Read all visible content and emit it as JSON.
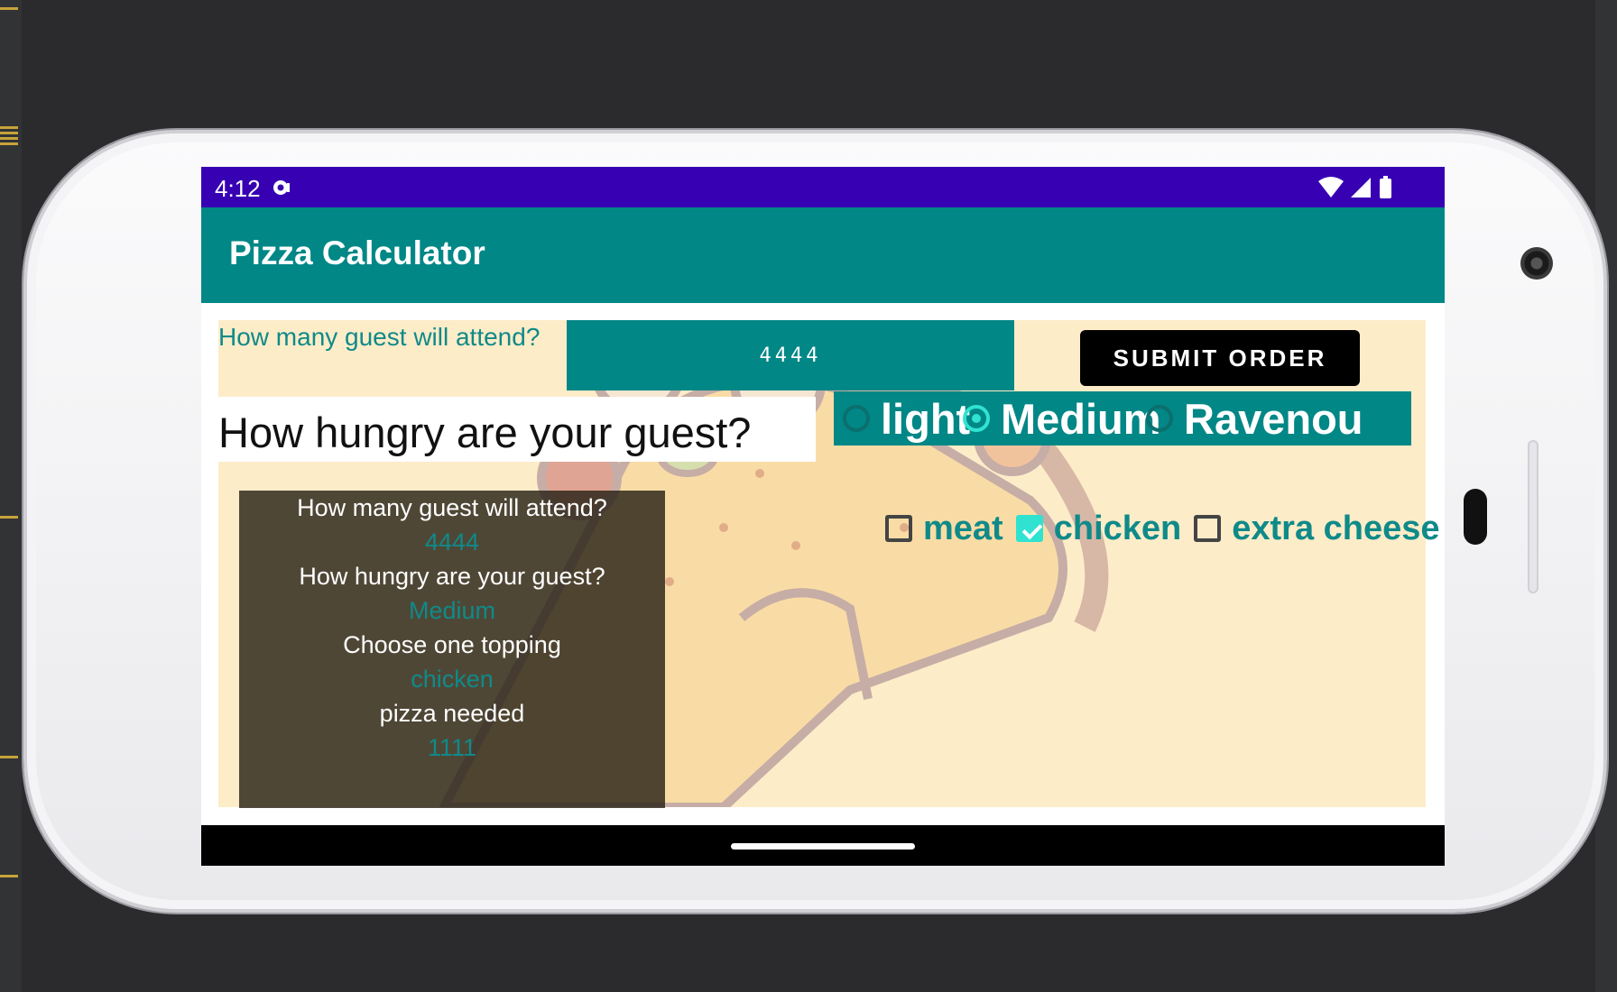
{
  "status_bar": {
    "time": "4:12",
    "icons": [
      "notification-icon",
      "wifi-icon",
      "cellular-signal-icon",
      "battery-icon"
    ]
  },
  "app_bar": {
    "title": "Pizza Calculator"
  },
  "form": {
    "guest_question": "How many guest will attend?",
    "guest_value": "4444",
    "submit_label": "SUBMIT ORDER",
    "hunger_question": "How hungry are your guest?",
    "hunger_options": [
      {
        "label": "light",
        "selected": false
      },
      {
        "label": "Medium",
        "selected": true
      },
      {
        "label": "Ravenou",
        "selected": false
      }
    ],
    "toppings": [
      {
        "label": "meat",
        "checked": false
      },
      {
        "label": "chicken",
        "checked": true
      },
      {
        "label": "extra cheese",
        "checked": false
      }
    ]
  },
  "summary": {
    "guest_label": "How many guest will attend?",
    "guest_value": "4444",
    "hunger_label": "How hungry are your guest?",
    "hunger_value": "Medium",
    "topping_label": "Choose one topping",
    "topping_value": "chicken",
    "pizza_label": "pizza needed",
    "pizza_value": "1111"
  },
  "colors": {
    "status_bar": "#3700b3",
    "primary": "#018786",
    "accent": "#2fe3d0",
    "background_image": "#fdecc8"
  },
  "background_image": "pizza-slice-illustration"
}
